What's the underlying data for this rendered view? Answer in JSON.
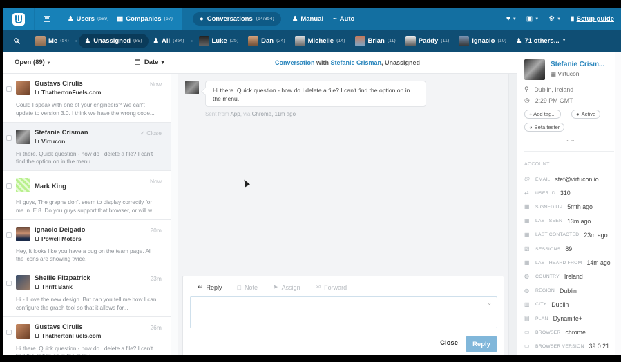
{
  "topnav": {
    "items": [
      {
        "label": "Users",
        "count": "(589)"
      },
      {
        "label": "Companies",
        "count": "(67)"
      },
      {
        "label": "Conversations",
        "count": "(54/354)"
      },
      {
        "label": "Manual",
        "count": ""
      },
      {
        "label": "Auto",
        "count": ""
      }
    ],
    "setup_guide": "Setup guide"
  },
  "subnav": {
    "items": [
      {
        "label": "Me",
        "count": "(54)"
      },
      {
        "label": "Unassigned",
        "count": "(89)"
      },
      {
        "label": "All",
        "count": "(354)"
      },
      {
        "label": "Luke",
        "count": "(25)"
      },
      {
        "label": "Dan",
        "count": "(24)"
      },
      {
        "label": "Michelle",
        "count": "(14)"
      },
      {
        "label": "Brian",
        "count": "(11)"
      },
      {
        "label": "Paddy",
        "count": "(11)"
      },
      {
        "label": "Ignacio",
        "count": "(10)"
      },
      {
        "label": "71 others...",
        "count": ""
      }
    ]
  },
  "list": {
    "filter": "Open (89)",
    "sort": "Date",
    "conversations": [
      {
        "name": "Gustavs Cirulis",
        "company": "ThathertonFuels.com",
        "time": "Now",
        "snippet": "Could I speak with one of your engineers? We can't update to version 3.0. I think we have the wrong code..."
      },
      {
        "name": "Stefanie Crisman",
        "company": "Virtucon",
        "time": "✓ Close",
        "snippet": "Hi there. Quick question - how do I delete a file? I can't find the option on in the menu."
      },
      {
        "name": "Mark King",
        "company": "",
        "time": "Now",
        "snippet": "Hi guys, The graphs don't seem to display correctly for me in IE 8. Do you guys support that browser, or will w..."
      },
      {
        "name": "Ignacio Delgado",
        "company": "Powell Motors",
        "time": "20m",
        "snippet": "Hey, It looks like you have a bug on the team page. All the icons are showing twice."
      },
      {
        "name": "Shellie Fitzpatrick",
        "company": "Thrift Bank",
        "time": "23m",
        "snippet": "Hi - I love the new design. But can you tell me how I can configure the graph tool so that it allows for..."
      },
      {
        "name": "Gustavs Cirulis",
        "company": "ThathertonFuels.com",
        "time": "26m",
        "snippet": "Hi there. Quick question - how do I delete a file? I can't find the option on in the menu."
      }
    ]
  },
  "conversation": {
    "header_link": "Conversation",
    "header_with": "with",
    "header_user": "Stefanie Crisman",
    "header_status": ", Unassigned",
    "message": "Hi there. Quick question - how do I delete a file? I can't find the option on in the menu.",
    "meta_sent": "Sent from",
    "meta_app": "App",
    "meta_via": ", via",
    "meta_browser": "Chrome",
    "meta_time": ", 11m ago"
  },
  "composer": {
    "tabs": [
      "Reply",
      "Note",
      "Assign",
      "Forward"
    ],
    "close": "Close",
    "reply": "Reply",
    "value": ""
  },
  "profile": {
    "name": "Stefanie Crism...",
    "company": "Virtucon",
    "location": "Dublin, Ireland",
    "time": "2:29 PM GMT",
    "tags": [
      "+ Add tag...",
      "Active",
      "Beta tester"
    ],
    "section": "ACCOUNT",
    "attributes": [
      {
        "key": "EMAIL",
        "value": "stef@virtucon.io",
        "icon": "@"
      },
      {
        "key": "USER ID",
        "value": "310",
        "icon": "⇄"
      },
      {
        "key": "SIGNED UP",
        "value": "5mth ago",
        "icon": "▦"
      },
      {
        "key": "LAST SEEN",
        "value": "13m ago",
        "icon": "▦"
      },
      {
        "key": "LAST CONTACTED",
        "value": "23m ago",
        "icon": "▦"
      },
      {
        "key": "SESSIONS",
        "value": "89",
        "icon": "▧"
      },
      {
        "key": "LAST HEARD FROM",
        "value": "14m ago",
        "icon": "▦"
      },
      {
        "key": "COUNTRY",
        "value": "Ireland",
        "icon": "◍"
      },
      {
        "key": "REGION",
        "value": "Dublin",
        "icon": "◍"
      },
      {
        "key": "CITY",
        "value": "Dublin",
        "icon": "▥"
      },
      {
        "key": "PLAN",
        "value": "Dynamite+",
        "icon": "▤"
      },
      {
        "key": "BROWSER",
        "value": "chrome",
        "icon": "▭"
      },
      {
        "key": "BROWSER VERSION",
        "value": "39.0.21...",
        "icon": "▭"
      }
    ]
  },
  "colors": {
    "brand": "#1781b8",
    "subnav": "#0f4e74",
    "link": "#2a86bd",
    "reply_button": "#81b7da"
  }
}
